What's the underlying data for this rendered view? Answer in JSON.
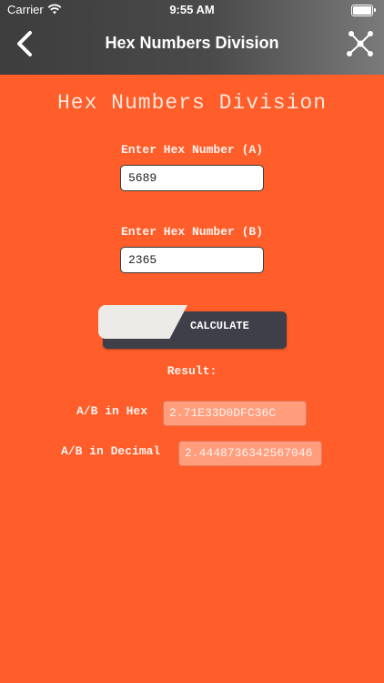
{
  "status_bar": {
    "carrier": "Carrier",
    "time": "9:55 AM"
  },
  "nav": {
    "title": "Hex Numbers Division",
    "back_icon": "chevron-left-icon",
    "share_icon": "share-network-icon"
  },
  "main": {
    "heading": "Hex Numbers Division",
    "input_a": {
      "label": "Enter Hex Number (A)",
      "value": "5689"
    },
    "input_b": {
      "label": "Enter Hex Number (B)",
      "value": "2365"
    },
    "calculate_label": "CALCULATE",
    "result_title": "Result:",
    "hex_result": {
      "label": "A/B in Hex",
      "value": "2.71E33D0DFC36C"
    },
    "decimal_result": {
      "label": "A/B in Decimal",
      "value": "2.4448736342567046"
    }
  },
  "colors": {
    "background": "#ff5d2a",
    "navbar": "#4a4a4a",
    "button_dark": "#3f3f4a",
    "button_light": "#ecebe7"
  }
}
